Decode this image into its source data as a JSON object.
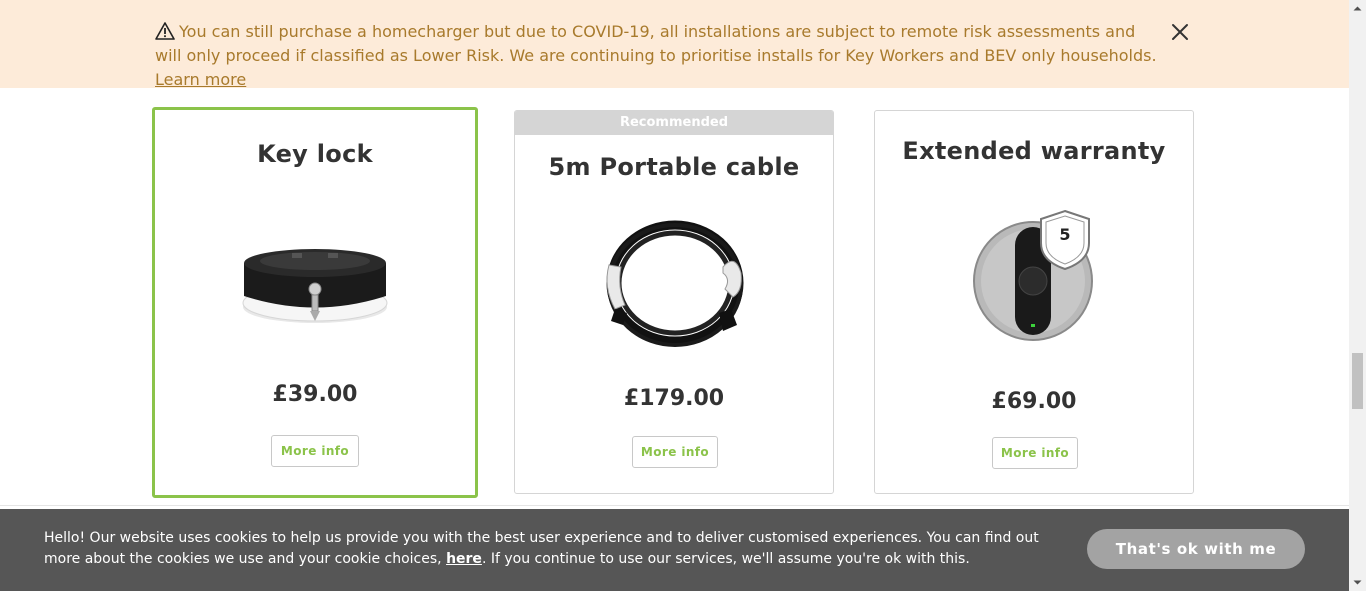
{
  "banner": {
    "message": "You can still purchase a homecharger but due to COVID-19, all installations are subject to remote risk assessments and will only proceed if classified as Lower Risk. We are continuing to prioritise installs for Key Workers and BEV only households.",
    "link_label": "Learn more",
    "icon": "warning-icon",
    "close_icon": "close-icon"
  },
  "products": [
    {
      "title": "Key lock",
      "price": "£39.00",
      "button": "More info",
      "selected": true,
      "ribbon": ""
    },
    {
      "title": "5m Portable cable",
      "price": "£179.00",
      "button": "More info",
      "selected": false,
      "ribbon": "Recommended"
    },
    {
      "title": "Extended warranty",
      "price": "£69.00",
      "button": "More info",
      "selected": false,
      "ribbon": "",
      "badge": "5"
    }
  ],
  "cookie": {
    "text_before": "Hello! Our website uses cookies to help us provide you with the best user experience and to deliver customised experiences. You can find out more about the cookies we use and your cookie choices, ",
    "link_label": "here",
    "text_after": ". If you continue to use our services, we'll assume you're ok with this.",
    "accept_label": "That's ok with me"
  },
  "colors": {
    "accent": "#8bc34a",
    "banner_bg": "#fdebd9",
    "banner_text": "#a87a2c",
    "cookie_bg": "#565656"
  }
}
